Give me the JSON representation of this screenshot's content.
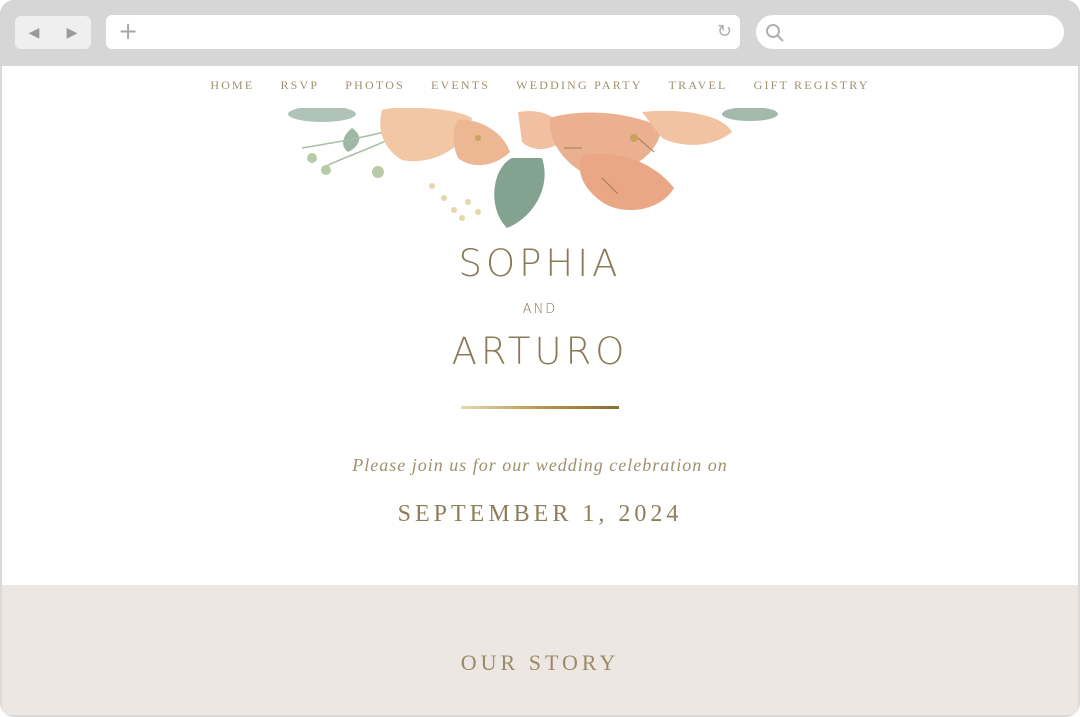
{
  "browser": {
    "back_icon": "◀",
    "forward_icon": "▶",
    "new_tab_icon": "+",
    "reload_icon": "↻",
    "url": "",
    "search_placeholder": ""
  },
  "nav": {
    "items": [
      {
        "label": "HOME"
      },
      {
        "label": "RSVP"
      },
      {
        "label": "PHOTOS"
      },
      {
        "label": "EVENTS"
      },
      {
        "label": "WEDDING PARTY"
      },
      {
        "label": "TRAVEL"
      },
      {
        "label": "GIFT REGISTRY"
      }
    ]
  },
  "hero": {
    "name1": "SOPHIA",
    "and": "AND",
    "name2": "ARTURO",
    "invite": "Please join us for our wedding celebration on",
    "date": "SEPTEMBER 1, 2024"
  },
  "story": {
    "heading": "OUR STORY"
  },
  "colors": {
    "accent_text": "#8b7a58",
    "nav_text": "#a0906e",
    "story_bg": "#ece7e3",
    "chrome_bg": "#d6d6d6"
  }
}
